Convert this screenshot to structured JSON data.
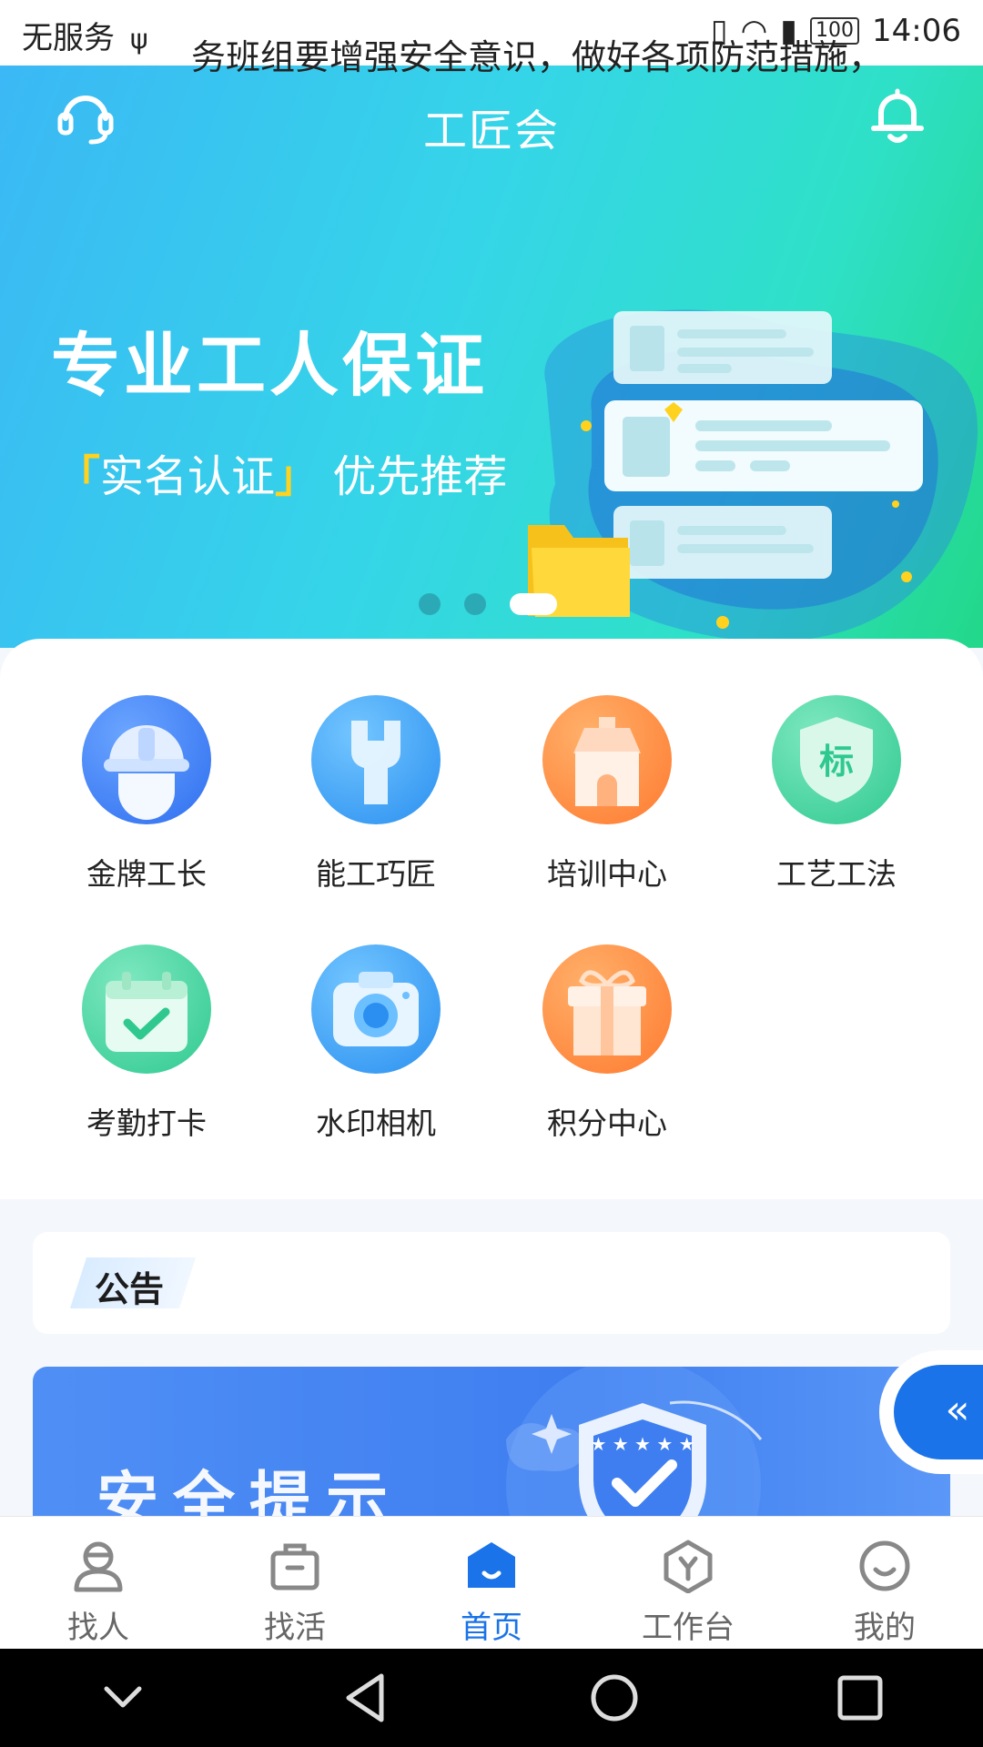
{
  "status_bar": {
    "carrier": "无服务",
    "battery": "100",
    "time": "14:06"
  },
  "header": {
    "title": "工匠会"
  },
  "banner": {
    "title": "专业工人保证",
    "subtitle_highlight": "实名认证",
    "subtitle_rest": "优先推荐",
    "slide_count": 3,
    "active_slide": 3
  },
  "menu": {
    "items": [
      {
        "label": "金牌工长",
        "icon": "helmet-icon"
      },
      {
        "label": "能工巧匠",
        "icon": "wrench-icon"
      },
      {
        "label": "培训中心",
        "icon": "house-icon"
      },
      {
        "label": "工艺工法",
        "icon": "standard-shield-icon",
        "icon_text": "标"
      },
      {
        "label": "考勤打卡",
        "icon": "calendar-check-icon"
      },
      {
        "label": "水印相机",
        "icon": "camera-icon"
      },
      {
        "label": "积分中心",
        "icon": "gift-icon"
      }
    ]
  },
  "notice": {
    "tag": "公告",
    "text": "务班组要增强安全意识，做好各项防范措施，"
  },
  "safety_card": {
    "title": "安全提示"
  },
  "tab_bar": {
    "tabs": [
      {
        "label": "找人",
        "icon": "person-icon",
        "active": false
      },
      {
        "label": "找活",
        "icon": "briefcase-icon",
        "active": false
      },
      {
        "label": "首页",
        "icon": "home-icon",
        "active": true
      },
      {
        "label": "工作台",
        "icon": "workbench-icon",
        "active": false
      },
      {
        "label": "我的",
        "icon": "smile-icon",
        "active": false
      }
    ]
  },
  "colors": {
    "accent": "#1a73e8",
    "banner_start": "#3bb8f5",
    "banner_end": "#22d889"
  }
}
